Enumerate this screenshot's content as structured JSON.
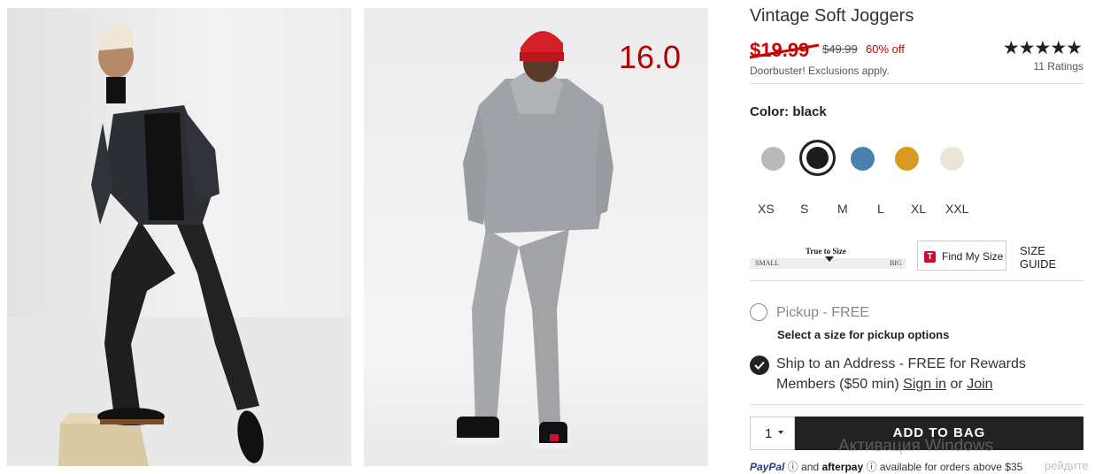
{
  "product": {
    "title": "Vintage Soft Joggers",
    "sale_price": "$19.99",
    "original_price": "$49.99",
    "discount": "60% off",
    "promo_note": "Doorbuster! Exclusions apply.",
    "stars": "★★★★★",
    "ratings_count": "11 Ratings"
  },
  "overlay_number": "16.0",
  "color": {
    "label": "Color: black",
    "swatches": [
      {
        "name": "grey",
        "hex": "#b9b9bb"
      },
      {
        "name": "black",
        "hex": "#1c1c1c",
        "selected": true
      },
      {
        "name": "blue",
        "hex": "#4a7fb0"
      },
      {
        "name": "gold",
        "hex": "#d99a22"
      },
      {
        "name": "cream",
        "hex": "#ece4d6"
      }
    ]
  },
  "sizes": [
    "XS",
    "S",
    "M",
    "L",
    "XL",
    "XXL"
  ],
  "fit": {
    "label": "True to Size",
    "small": "SMALL",
    "big": "BIG"
  },
  "find_my_size": "Find My Size",
  "size_guide": "SIZE GUIDE",
  "fulfillment": {
    "pickup_label": "Pickup - FREE",
    "pickup_note": "Select a size for pickup options",
    "ship_line1": "Ship to an Address - FREE for Rewards",
    "ship_line2_prefix": "Members ($50 min)",
    "sign_in": "Sign in",
    "or": "or",
    "join": "Join"
  },
  "quantity": "1",
  "add_to_bag": "ADD TO BAG",
  "payment": {
    "paypal": "PayPal",
    "and": "and",
    "afterpay": "afterpay",
    "note": "available for orders above $35"
  },
  "watermark": {
    "line1": "Активация Windows",
    "line2": "рейдите"
  },
  "colors": {
    "sale_red": "#cc0000",
    "button_dark": "#222222"
  }
}
